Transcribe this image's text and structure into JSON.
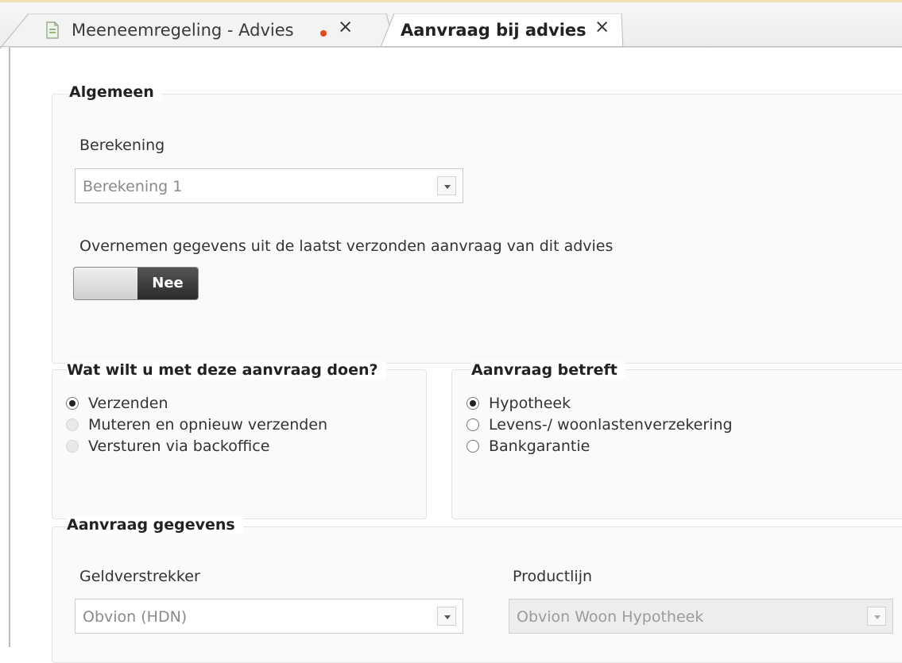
{
  "tabs": [
    {
      "label": "Meeneemregeling - Advies",
      "close": "×",
      "modified": true,
      "active": false
    },
    {
      "label": "Aanvraag bij advies",
      "close": "×",
      "modified": false,
      "active": true
    }
  ],
  "algemeen": {
    "title": "Algemeen",
    "berekening_label": "Berekening",
    "berekening_value": "Berekening 1",
    "overnemen_label": "Overnemen gegevens uit de laatst verzonden aanvraag van dit advies",
    "toggle_value": "Nee"
  },
  "actie": {
    "title": "Wat wilt u met deze aanvraag doen?",
    "options": [
      {
        "label": "Verzenden",
        "checked": true,
        "enabled": true
      },
      {
        "label": "Muteren en opnieuw verzenden",
        "checked": false,
        "enabled": false
      },
      {
        "label": "Versturen via backoffice",
        "checked": false,
        "enabled": false
      }
    ]
  },
  "betreft": {
    "title": "Aanvraag betreft",
    "options": [
      {
        "label": "Hypotheek",
        "checked": true,
        "enabled": true
      },
      {
        "label": "Levens-/ woonlastenverzekering",
        "checked": false,
        "enabled": true
      },
      {
        "label": "Bankgarantie",
        "checked": false,
        "enabled": true
      }
    ]
  },
  "gegevens": {
    "title": "Aanvraag gegevens",
    "geldverstrekker_label": "Geldverstrekker",
    "geldverstrekker_value": "Obvion (HDN)",
    "productlijn_label": "Productlijn",
    "productlijn_value": "Obvion Woon Hypotheek"
  },
  "colors": {
    "modified_dot": "#e24a1a",
    "toggle_dark": "#333333"
  }
}
